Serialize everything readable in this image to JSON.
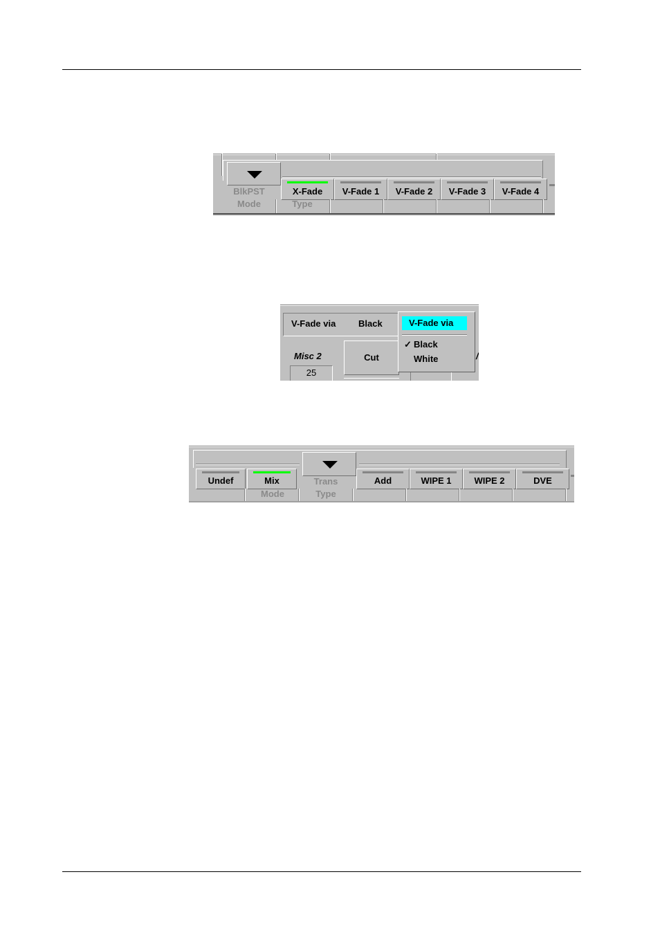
{
  "panel1": {
    "dropdown_icon": "triangle-down-icon",
    "mode_value": "BlkPST",
    "mode_label": "Mode",
    "type_label": "Type",
    "buttons": [
      {
        "label": "X-Fade",
        "active": true
      },
      {
        "label": "V-Fade 1",
        "active": false
      },
      {
        "label": "V-Fade 2",
        "active": false
      },
      {
        "label": "V-Fade 3",
        "active": false
      },
      {
        "label": "V-Fade 4",
        "active": false
      }
    ]
  },
  "panel2": {
    "field_label": "V-Fade via",
    "field_value": "Black",
    "misc_label": "Misc 2",
    "misc_value": "25",
    "cut_label": "Cut",
    "partial_value": "25",
    "menu": {
      "title": "V-Fade via",
      "title_color": "#00ffff",
      "items": [
        {
          "label": "Black",
          "checked": true
        },
        {
          "label": "White",
          "checked": false
        }
      ],
      "check_icon": "✓"
    }
  },
  "panel3": {
    "dropdown_icon": "triangle-down-icon",
    "mode_label": "Mode",
    "trans_value": "Trans",
    "type_label": "Type",
    "left_buttons": [
      {
        "label": "Undef",
        "active": false
      },
      {
        "label": "Mix",
        "active": true
      }
    ],
    "right_buttons": [
      {
        "label": "Add",
        "active": false
      },
      {
        "label": "WIPE 1",
        "active": false
      },
      {
        "label": "WIPE 2",
        "active": false
      },
      {
        "label": "DVE",
        "active": false
      }
    ]
  },
  "colors": {
    "panel_bg": "#c0c0c0",
    "active_lamp": "#00ff00",
    "inactive_lamp": "#858585",
    "menu_highlight": "#00ffff"
  }
}
